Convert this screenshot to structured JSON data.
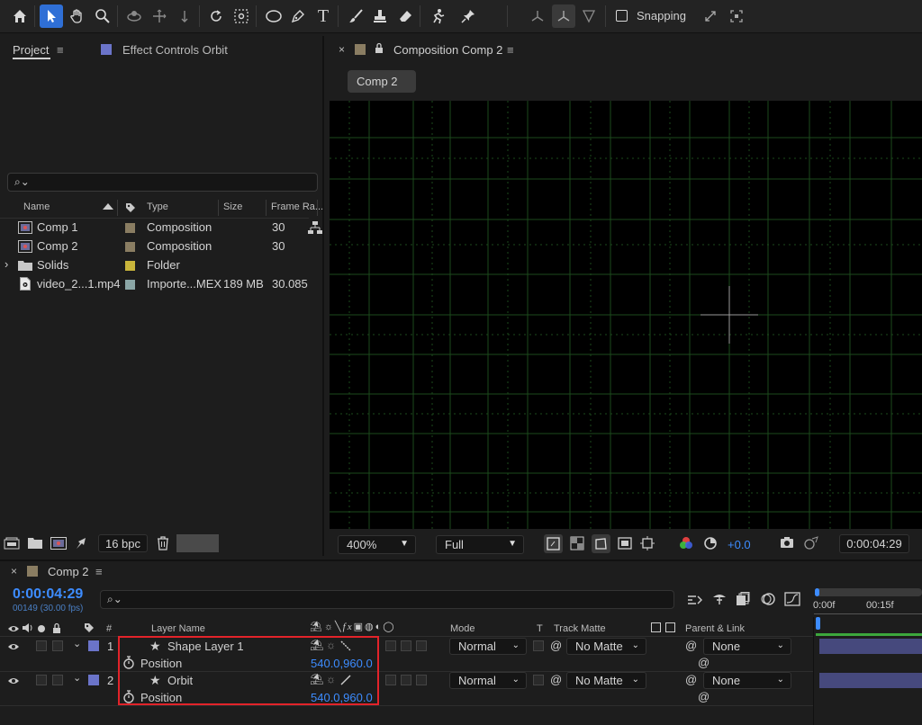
{
  "toolbar": {
    "snapping_label": "Snapping",
    "icons": [
      "home-icon",
      "selection-tool-icon",
      "hand-tool-icon",
      "zoom-tool-icon",
      "orbit-camera-icon",
      "pan-camera-icon",
      "dolly-camera-icon",
      "rotate-tool-icon",
      "anchor-point-tool-icon",
      "shape-tool-icon",
      "pen-tool-icon",
      "type-tool-icon",
      "brush-tool-icon",
      "clone-stamp-icon",
      "eraser-tool-icon",
      "roto-brush-icon",
      "puppet-pin-icon"
    ]
  },
  "project_panel": {
    "tab_project": "Project",
    "tab_effect_controls": "Effect Controls Orbit",
    "columns": {
      "name": "Name",
      "type": "Type",
      "size": "Size",
      "frame_rate": "Frame Ra..."
    },
    "items": [
      {
        "name": "Comp 1",
        "type": "Composition",
        "size": "",
        "frame_rate": "30",
        "label_color": "#8a7d62"
      },
      {
        "name": "Comp 2",
        "type": "Composition",
        "size": "",
        "frame_rate": "30",
        "label_color": "#8a7d62"
      },
      {
        "name": "Solids",
        "type": "Folder",
        "size": "",
        "frame_rate": "",
        "label_color": "#c9b53b"
      },
      {
        "name": "video_2...1.mp4",
        "type": "Importe...MEX",
        "size": "189 MB",
        "frame_rate": "30.085",
        "label_color": "#8aa5a5"
      }
    ],
    "bit_depth": "16 bpc"
  },
  "composition_panel": {
    "title": "Composition Comp 2",
    "tab_chip": "Comp 2",
    "zoom": "400%",
    "resolution": "Full",
    "exposure": "+0.0",
    "timecode": "0:00:04:29"
  },
  "timeline": {
    "tab": "Comp 2",
    "current_time": "0:00:04:29",
    "frame_info": "00149 (30.00 fps)",
    "columns": {
      "num": "#",
      "layer_name": "Layer Name",
      "mode": "Mode",
      "t": "T",
      "track_matte": "Track Matte",
      "parent": "Parent & Link"
    },
    "ruler": [
      "0:00f",
      "00:15f"
    ],
    "layers": [
      {
        "num": "1",
        "name": "Shape Layer 1",
        "mode": "Normal",
        "matte": "No Matte",
        "parent": "None",
        "property": "Position",
        "value": "540.0,960.0"
      },
      {
        "num": "2",
        "name": "Orbit",
        "mode": "Normal",
        "matte": "No Matte",
        "parent": "None",
        "property": "Position",
        "value": "540.0,960.0"
      }
    ],
    "colors": {
      "accent_blue": "#3d8cff",
      "label_blue": "#6b74c9",
      "highlight_red": "#e2232a",
      "track_purple": "#46497d"
    }
  }
}
